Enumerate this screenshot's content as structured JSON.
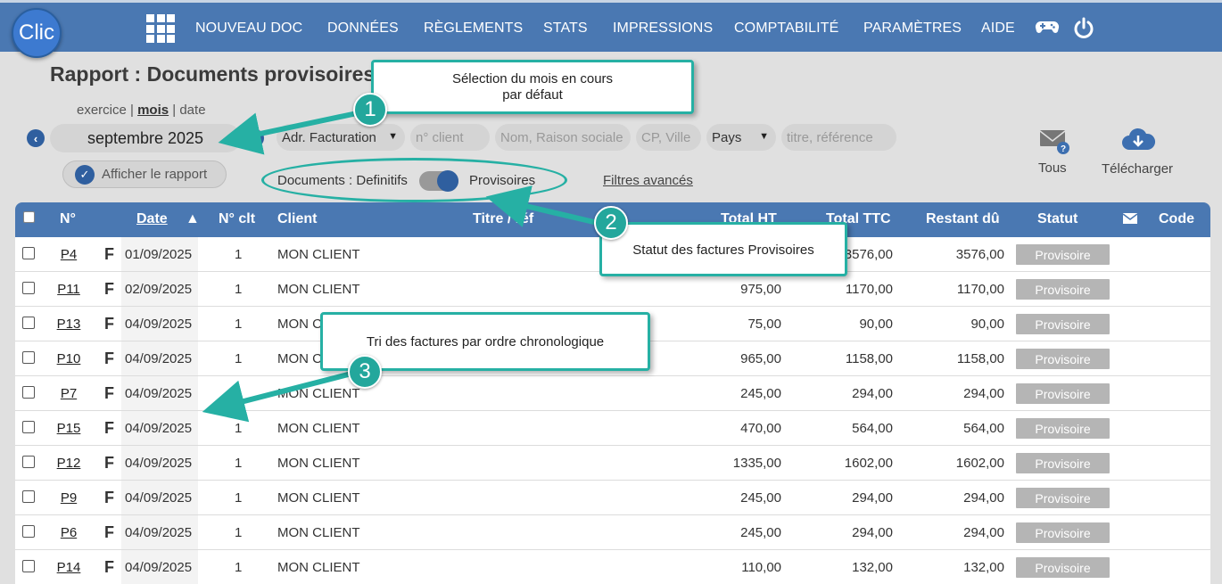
{
  "logo": "Clic",
  "nav": {
    "items": [
      "NOUVEAU DOC",
      "DONNÉES",
      "RÈGLEMENTS",
      "STATS",
      "IMPRESSIONS",
      "COMPTABILITÉ",
      "PARAMÈTRES",
      "AIDE"
    ],
    "icons": [
      "grid-menu-icon",
      "gamepad-icon",
      "power-icon"
    ]
  },
  "page": {
    "title": "Rapport : Documents provisoires"
  },
  "period": {
    "options": [
      "exercice",
      "mois",
      "date"
    ],
    "selected": "mois",
    "value": "septembre 2025"
  },
  "filters": {
    "address_type": "Adr. Facturation",
    "client_no_placeholder": "n° client",
    "name_placeholder": "Nom, Raison sociale",
    "city_placeholder": "CP, Ville",
    "country": "Pays",
    "title_placeholder": "titre, référence",
    "show_report": "Afficher le rapport",
    "documents_label": "Documents : Definitifs",
    "provisional_label": "Provisoires",
    "advanced": "Filtres avancés"
  },
  "actions": {
    "all": "Tous",
    "download": "Télécharger"
  },
  "table": {
    "headers": [
      "N°",
      "Date",
      "N° clt",
      "Client",
      "Titre / réf",
      "Total HT",
      "Total TTC",
      "Restant dû",
      "Statut",
      "Code"
    ],
    "sort_indicator": "▲",
    "rows": [
      {
        "num": "P4",
        "type": "F",
        "date": "01/09/2025",
        "clt": "1",
        "client": "MON CLIENT",
        "ht": "",
        "ttc": "3576,00",
        "due": "3576,00",
        "status": "Provisoire"
      },
      {
        "num": "P11",
        "type": "F",
        "date": "02/09/2025",
        "clt": "1",
        "client": "MON CLIENT",
        "ht": "975,00",
        "ttc": "1170,00",
        "due": "1170,00",
        "status": "Provisoire"
      },
      {
        "num": "P13",
        "type": "F",
        "date": "04/09/2025",
        "clt": "1",
        "client": "MON C",
        "ht": "75,00",
        "ttc": "90,00",
        "due": "90,00",
        "status": "Provisoire"
      },
      {
        "num": "P10",
        "type": "F",
        "date": "04/09/2025",
        "clt": "1",
        "client": "MON C",
        "ht": "965,00",
        "ttc": "1158,00",
        "due": "1158,00",
        "status": "Provisoire"
      },
      {
        "num": "P7",
        "type": "F",
        "date": "04/09/2025",
        "clt": "1",
        "client": "MON CLIENT",
        "ht": "245,00",
        "ttc": "294,00",
        "due": "294,00",
        "status": "Provisoire"
      },
      {
        "num": "P15",
        "type": "F",
        "date": "04/09/2025",
        "clt": "1",
        "client": "MON CLIENT",
        "ht": "470,00",
        "ttc": "564,00",
        "due": "564,00",
        "status": "Provisoire"
      },
      {
        "num": "P12",
        "type": "F",
        "date": "04/09/2025",
        "clt": "1",
        "client": "MON CLIENT",
        "ht": "1335,00",
        "ttc": "1602,00",
        "due": "1602,00",
        "status": "Provisoire"
      },
      {
        "num": "P9",
        "type": "F",
        "date": "04/09/2025",
        "clt": "1",
        "client": "MON CLIENT",
        "ht": "245,00",
        "ttc": "294,00",
        "due": "294,00",
        "status": "Provisoire"
      },
      {
        "num": "P6",
        "type": "F",
        "date": "04/09/2025",
        "clt": "1",
        "client": "MON CLIENT",
        "ht": "245,00",
        "ttc": "294,00",
        "due": "294,00",
        "status": "Provisoire"
      },
      {
        "num": "P14",
        "type": "F",
        "date": "04/09/2025",
        "clt": "1",
        "client": "MON CLIENT",
        "ht": "110,00",
        "ttc": "132,00",
        "due": "132,00",
        "status": "Provisoire"
      }
    ]
  },
  "annotations": {
    "callout1_line1": "Sélection du mois en cours",
    "callout1_line2": "par défaut",
    "callout2": "Statut des factures Provisoires",
    "callout3": "Tri des factures  par ordre chronologique",
    "numbers": [
      "1",
      "2",
      "3"
    ],
    "accent_color": "#26b0a4"
  },
  "colors": {
    "nav": "#4a78b2",
    "status_badge": "#b5b5b5",
    "page_bg": "#e0e0e0"
  }
}
